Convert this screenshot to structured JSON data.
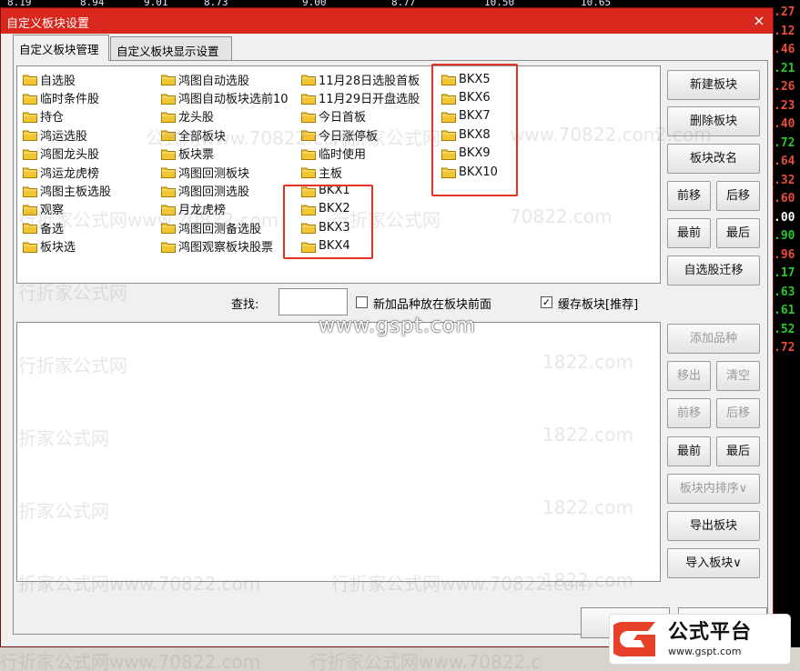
{
  "background": {
    "ticker_top": [
      "8.19",
      "8.94",
      "9.01",
      "8.73",
      "9.00",
      "8.77",
      "10.50",
      "10.65"
    ],
    "ticker_right": [
      {
        "text": ".27",
        "color": "#e94b3c"
      },
      {
        "text": ".12",
        "color": "#e94b3c"
      },
      {
        "text": ".46",
        "color": "#e94b3c"
      },
      {
        "text": ".21",
        "color": "#27c72b"
      },
      {
        "text": ".26",
        "color": "#e94b3c"
      },
      {
        "text": ".23",
        "color": "#e94b3c"
      },
      {
        "text": ".40",
        "color": "#e94b3c"
      },
      {
        "text": ".72",
        "color": "#27c72b"
      },
      {
        "text": ".64",
        "color": "#e94b3c"
      },
      {
        "text": ".32",
        "color": "#e94b3c"
      },
      {
        "text": ".60",
        "color": "#e94b3c"
      },
      {
        "text": ".00",
        "color": "#ffffff"
      },
      {
        "text": ".90",
        "color": "#27c72b"
      },
      {
        "text": ".96",
        "color": "#e94b3c"
      },
      {
        "text": ".17",
        "color": "#27c72b"
      },
      {
        "text": ".63",
        "color": "#27c72b"
      },
      {
        "text": ".61",
        "color": "#27c72b"
      },
      {
        "text": ".52",
        "color": "#27c72b"
      },
      {
        "text": ".72",
        "color": "#e94b3c"
      }
    ],
    "watermarks": [
      "公式网www.70822.com",
      "行折家公式网",
      "www.70822.com",
      "2.com",
      "行折家公式网www.70822.com",
      "行折家公式网",
      "70822.com",
      "行折家公式网",
      "1822.com",
      "行折家公式网",
      "1822.com",
      "折家公式网",
      "1822.com",
      "折家公式网",
      "1822.com",
      "折家公式网www.70822.com",
      "行折家公式网www.70822.com",
      "行折家公式网www.70822.com",
      "行折家公式网www.70822.c"
    ]
  },
  "dialog": {
    "title": "自定义板块设置",
    "close_glyph": "×",
    "tabs": [
      "自定义板块管理",
      "自定义板块显示设置"
    ]
  },
  "blocks": {
    "columns": [
      [
        "自选股",
        "临时条件股",
        "持仓",
        "鸿运选股",
        "鸿图龙头股",
        "鸿运龙虎榜",
        "鸿图主板选股",
        "观察",
        "备选",
        "板块选"
      ],
      [
        "鸿图自动选股",
        "鸿图自动板块选前10",
        "龙头股",
        "全部板块",
        "板块票",
        "鸿图回测板块",
        "鸿图回测选股",
        "月龙虎榜",
        "鸿图回测备选股",
        "鸿图观察板块股票"
      ],
      [
        "11月28日选股首板",
        "11月29日开盘选股",
        "今日首板",
        "今日涨停板",
        "临时使用",
        "主板",
        "BKX1",
        "BKX2",
        "BKX3",
        "BKX4"
      ],
      [
        "BKX5",
        "BKX6",
        "BKX7",
        "BKX8",
        "BKX9",
        "BKX10"
      ]
    ]
  },
  "side_buttons": {
    "new": "新建板块",
    "delete": "删除板块",
    "rename": "板块改名",
    "move_up": "前移",
    "move_down": "后移",
    "first": "最前",
    "last": "最后",
    "migrate": "自选股迁移"
  },
  "search": {
    "label": "查找:",
    "value": "",
    "new_front_label": "新加品种放在板块前面",
    "new_front_checked": false,
    "cache_label": "缓存板块[推荐]",
    "cache_checked": true,
    "check_glyph": "✓"
  },
  "url_watermark": "www.gspt.com",
  "stock_buttons": {
    "add": "添加品种",
    "remove": "移出",
    "clear": "清空",
    "move_up": "前移",
    "move_down": "后移",
    "first": "最前",
    "last": "最后",
    "sort": "板块内排序∨",
    "export": "导出板块",
    "import": "导入板块∨"
  },
  "logo": {
    "cn": "公式平台",
    "en": "www.gspt.com"
  },
  "colors": {
    "title_bar": "#d8271c",
    "highlight_box": "#e53228",
    "folder": "#f2c533"
  }
}
